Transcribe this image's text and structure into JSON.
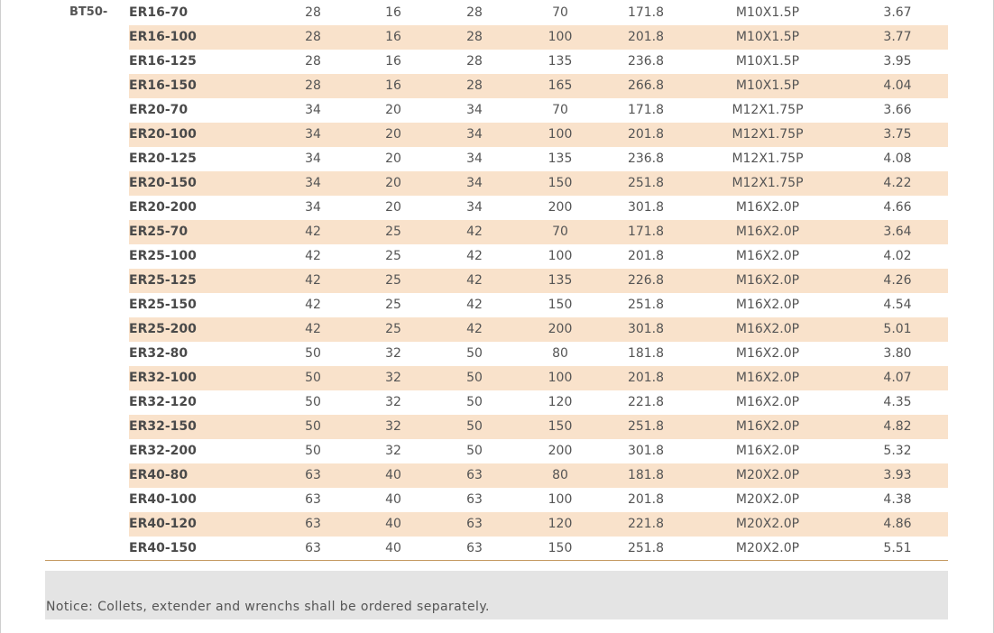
{
  "group_label": "BT50-",
  "rows": [
    [
      "ER16-70",
      "28",
      "16",
      "28",
      "70",
      "171.8",
      "M10X1.5P",
      "3.67"
    ],
    [
      "ER16-100",
      "28",
      "16",
      "28",
      "100",
      "201.8",
      "M10X1.5P",
      "3.77"
    ],
    [
      "ER16-125",
      "28",
      "16",
      "28",
      "135",
      "236.8",
      "M10X1.5P",
      "3.95"
    ],
    [
      "ER16-150",
      "28",
      "16",
      "28",
      "165",
      "266.8",
      "M10X1.5P",
      "4.04"
    ],
    [
      "ER20-70",
      "34",
      "20",
      "34",
      "70",
      "171.8",
      "M12X1.75P",
      "3.66"
    ],
    [
      "ER20-100",
      "34",
      "20",
      "34",
      "100",
      "201.8",
      "M12X1.75P",
      "3.75"
    ],
    [
      "ER20-125",
      "34",
      "20",
      "34",
      "135",
      "236.8",
      "M12X1.75P",
      "4.08"
    ],
    [
      "ER20-150",
      "34",
      "20",
      "34",
      "150",
      "251.8",
      "M12X1.75P",
      "4.22"
    ],
    [
      "ER20-200",
      "34",
      "20",
      "34",
      "200",
      "301.8",
      "M16X2.0P",
      "4.66"
    ],
    [
      "ER25-70",
      "42",
      "25",
      "42",
      "70",
      "171.8",
      "M16X2.0P",
      "3.64"
    ],
    [
      "ER25-100",
      "42",
      "25",
      "42",
      "100",
      "201.8",
      "M16X2.0P",
      "4.02"
    ],
    [
      "ER25-125",
      "42",
      "25",
      "42",
      "135",
      "226.8",
      "M16X2.0P",
      "4.26"
    ],
    [
      "ER25-150",
      "42",
      "25",
      "42",
      "150",
      "251.8",
      "M16X2.0P",
      "4.54"
    ],
    [
      "ER25-200",
      "42",
      "25",
      "42",
      "200",
      "301.8",
      "M16X2.0P",
      "5.01"
    ],
    [
      "ER32-80",
      "50",
      "32",
      "50",
      "80",
      "181.8",
      "M16X2.0P",
      "3.80"
    ],
    [
      "ER32-100",
      "50",
      "32",
      "50",
      "100",
      "201.8",
      "M16X2.0P",
      "4.07"
    ],
    [
      "ER32-120",
      "50",
      "32",
      "50",
      "120",
      "221.8",
      "M16X2.0P",
      "4.35"
    ],
    [
      "ER32-150",
      "50",
      "32",
      "50",
      "150",
      "251.8",
      "M16X2.0P",
      "4.82"
    ],
    [
      "ER32-200",
      "50",
      "32",
      "50",
      "200",
      "301.8",
      "M16X2.0P",
      "5.32"
    ],
    [
      "ER40-80",
      "63",
      "40",
      "63",
      "80",
      "181.8",
      "M20X2.0P",
      "3.93"
    ],
    [
      "ER40-100",
      "63",
      "40",
      "63",
      "100",
      "201.8",
      "M20X2.0P",
      "4.38"
    ],
    [
      "ER40-120",
      "63",
      "40",
      "63",
      "120",
      "221.8",
      "M20X2.0P",
      "4.86"
    ],
    [
      "ER40-150",
      "63",
      "40",
      "63",
      "150",
      "251.8",
      "M20X2.0P",
      "5.51"
    ]
  ],
  "notice": "Notice: Collets, extender and wrenchs shall be ordered separately.",
  "colors": {
    "row_stripe": "#f9e2cb",
    "rule": "#c59a62",
    "notice_bg": "#e4e4e4"
  }
}
